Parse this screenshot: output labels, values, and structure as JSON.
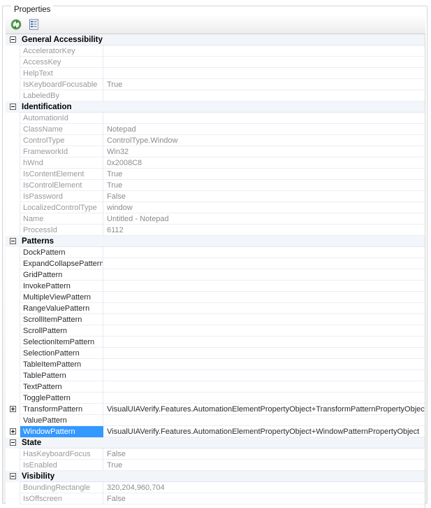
{
  "panel": {
    "title": "Properties"
  },
  "toolbar": {
    "buttons": [
      {
        "name": "refresh-icon",
        "label": "Refresh"
      },
      {
        "name": "properties-list-icon",
        "label": "Properties"
      }
    ]
  },
  "colors": {
    "selection": "#3399ff",
    "category_background": "#f2f5fa",
    "grid_line": "#eaeef4",
    "label_text": "#9a9a9a",
    "value_text": "#8c8c8c"
  },
  "grid": {
    "rows": [
      {
        "kind": "category",
        "expander": "minus",
        "name": "General Accessibility",
        "value": ""
      },
      {
        "kind": "property",
        "expander": "none",
        "name": "AcceleratorKey",
        "value": ""
      },
      {
        "kind": "property",
        "expander": "none",
        "name": "AccessKey",
        "value": ""
      },
      {
        "kind": "property",
        "expander": "none",
        "name": "HelpText",
        "value": ""
      },
      {
        "kind": "property",
        "expander": "none",
        "name": "IsKeyboardFocusable",
        "value": "True"
      },
      {
        "kind": "property",
        "expander": "none",
        "name": "LabeledBy",
        "value": ""
      },
      {
        "kind": "category",
        "expander": "minus",
        "name": "Identification",
        "value": ""
      },
      {
        "kind": "property",
        "expander": "none",
        "name": "AutomationId",
        "value": ""
      },
      {
        "kind": "property",
        "expander": "none",
        "name": "ClassName",
        "value": "Notepad"
      },
      {
        "kind": "property",
        "expander": "none",
        "name": "ControlType",
        "value": "ControlType.Window"
      },
      {
        "kind": "property",
        "expander": "none",
        "name": "FrameworkId",
        "value": "Win32"
      },
      {
        "kind": "property",
        "expander": "none",
        "name": "hWnd",
        "value": "0x2008C8"
      },
      {
        "kind": "property",
        "expander": "none",
        "name": "IsContentElement",
        "value": "True"
      },
      {
        "kind": "property",
        "expander": "none",
        "name": "IsControlElement",
        "value": "True"
      },
      {
        "kind": "property",
        "expander": "none",
        "name": "IsPassword",
        "value": "False"
      },
      {
        "kind": "property",
        "expander": "none",
        "name": "LocalizedControlType",
        "value": "window"
      },
      {
        "kind": "property",
        "expander": "none",
        "name": "Name",
        "value": "Untitled - Notepad"
      },
      {
        "kind": "property",
        "expander": "none",
        "name": "ProcessId",
        "value": "6112"
      },
      {
        "kind": "category",
        "expander": "minus",
        "name": "Patterns",
        "value": ""
      },
      {
        "kind": "pattern",
        "expander": "none",
        "name": "DockPattern",
        "value": ""
      },
      {
        "kind": "pattern",
        "expander": "none",
        "name": "ExpandCollapsePattern",
        "value": ""
      },
      {
        "kind": "pattern",
        "expander": "none",
        "name": "GridPattern",
        "value": ""
      },
      {
        "kind": "pattern",
        "expander": "none",
        "name": "InvokePattern",
        "value": ""
      },
      {
        "kind": "pattern",
        "expander": "none",
        "name": "MultipleViewPattern",
        "value": ""
      },
      {
        "kind": "pattern",
        "expander": "none",
        "name": "RangeValuePattern",
        "value": ""
      },
      {
        "kind": "pattern",
        "expander": "none",
        "name": "ScrollItemPattern",
        "value": ""
      },
      {
        "kind": "pattern",
        "expander": "none",
        "name": "ScrollPattern",
        "value": ""
      },
      {
        "kind": "pattern",
        "expander": "none",
        "name": "SelectionItemPattern",
        "value": ""
      },
      {
        "kind": "pattern",
        "expander": "none",
        "name": "SelectionPattern",
        "value": ""
      },
      {
        "kind": "pattern",
        "expander": "none",
        "name": "TableItemPattern",
        "value": ""
      },
      {
        "kind": "pattern",
        "expander": "none",
        "name": "TablePattern",
        "value": ""
      },
      {
        "kind": "pattern",
        "expander": "none",
        "name": "TextPattern",
        "value": ""
      },
      {
        "kind": "pattern",
        "expander": "none",
        "name": "TogglePattern",
        "value": ""
      },
      {
        "kind": "pattern",
        "expander": "plus",
        "name": "TransformPattern",
        "value": "VisualUIAVerify.Features.AutomationElementPropertyObject+TransformPatternPropertyObject"
      },
      {
        "kind": "pattern",
        "expander": "none",
        "name": "ValuePattern",
        "value": ""
      },
      {
        "kind": "pattern",
        "expander": "plus",
        "selected": true,
        "name": "WindowPattern",
        "value": "VisualUIAVerify.Features.AutomationElementPropertyObject+WindowPatternPropertyObject"
      },
      {
        "kind": "category",
        "expander": "minus",
        "name": "State",
        "value": ""
      },
      {
        "kind": "property",
        "expander": "none",
        "name": "HasKeyboardFocus",
        "value": "False"
      },
      {
        "kind": "property",
        "expander": "none",
        "name": "IsEnabled",
        "value": "True"
      },
      {
        "kind": "category",
        "expander": "minus",
        "name": "Visibility",
        "value": ""
      },
      {
        "kind": "property",
        "expander": "none",
        "name": "BoundingRectangle",
        "value": "320,204,960,704"
      },
      {
        "kind": "property",
        "expander": "none",
        "name": "IsOffscreen",
        "value": "False"
      }
    ]
  }
}
